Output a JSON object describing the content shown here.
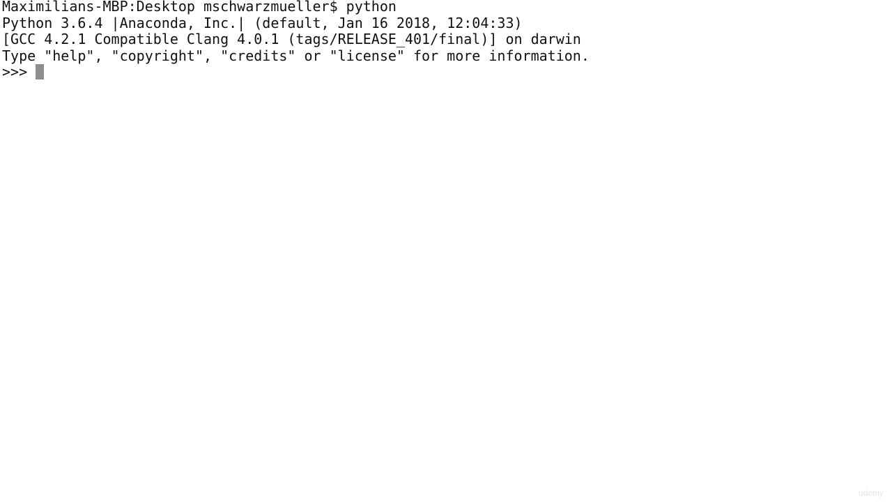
{
  "terminal": {
    "lines": [
      "Maximilians-MBP:Desktop mschwarzmueller$ python",
      "Python 3.6.4 |Anaconda, Inc.| (default, Jan 16 2018, 12:04:33)",
      "[GCC 4.2.1 Compatible Clang 4.0.1 (tags/RELEASE_401/final)] on darwin",
      "Type \"help\", \"copyright\", \"credits\" or \"license\" for more information."
    ],
    "prompt": ">>>",
    "cursor_color": "#8e8e8e"
  },
  "watermark": {
    "text": "udemy"
  }
}
